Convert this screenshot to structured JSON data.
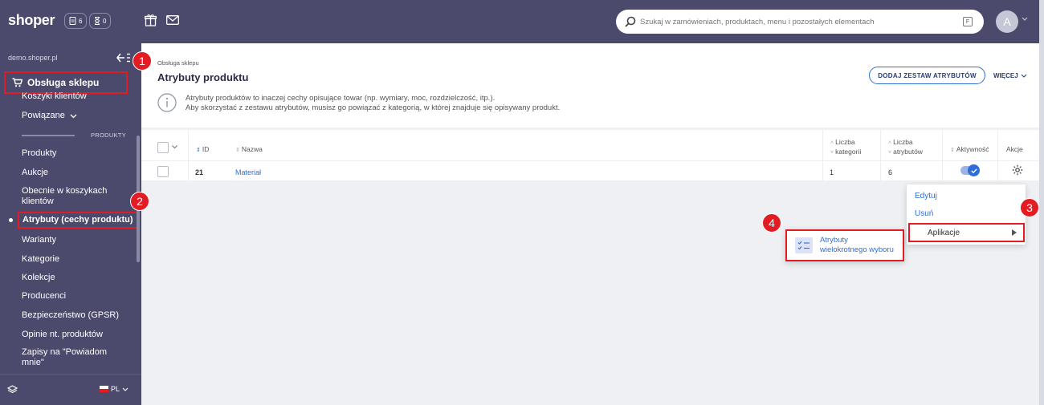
{
  "topbar": {
    "logo": "shoper",
    "orders_count": "6",
    "pending_count": "0",
    "search_placeholder": "Szukaj w zamówieniach, produktach, menu i pozostałych elementach",
    "avatar_letter": "A"
  },
  "sidebar": {
    "store_url": "demo.shoper.pl",
    "section_title": "Obsługa sklepu",
    "items": [
      {
        "label": "Koszyki klientów"
      },
      {
        "label": "Powiązane"
      },
      {
        "label": "Produkty"
      },
      {
        "label": "Aukcje"
      },
      {
        "label": "Obecnie w koszykach klientów"
      },
      {
        "label": "Atrybuty (cechy produktu)"
      },
      {
        "label": "Warianty"
      },
      {
        "label": "Kategorie"
      },
      {
        "label": "Kolekcje"
      },
      {
        "label": "Producenci"
      },
      {
        "label": "Bezpieczeństwo (GPSR)"
      },
      {
        "label": "Opinie nt. produktów"
      },
      {
        "label": "Zapisy na \"Powiadom mnie\""
      }
    ],
    "category_label": "PRODUKTY",
    "language": "PL"
  },
  "page": {
    "breadcrumb": "Obsługa sklepu",
    "title": "Atrybuty produktu",
    "add_button": "DODAJ ZESTAW ATRYBUTÓW",
    "more_label": "WIĘCEJ",
    "info_line1": "Atrybuty produktów to inaczej cechy opisujące towar (np. wymiary, moc, rozdzielczość, itp.).",
    "info_line2": "Aby skorzystać z zestawu atrybutów, musisz go powiązać z kategorią, w której znajduje się opisywany produkt."
  },
  "table": {
    "headers": {
      "id": "ID",
      "name": "Nazwa",
      "categories_1": "Liczba",
      "categories_2": "kategorii",
      "attributes_1": "Liczba",
      "attributes_2": "atrybutów",
      "active": "Aktywność",
      "actions": "Akcje"
    },
    "rows": [
      {
        "id": "21",
        "name": "Materiał",
        "categories": "1",
        "attributes": "6",
        "active": true
      }
    ]
  },
  "context_menu": {
    "edit": "Edytuj",
    "delete": "Usuń",
    "applications": "Aplikacje"
  },
  "submenu": {
    "line1": "Atrybuty",
    "line2": "wielokrotnego wyboru"
  },
  "badges": [
    "1",
    "2",
    "3",
    "4"
  ],
  "colors": {
    "navy": "#4b4a6c",
    "highlight_red": "#e31b23",
    "link_blue": "#2d6fd6"
  }
}
